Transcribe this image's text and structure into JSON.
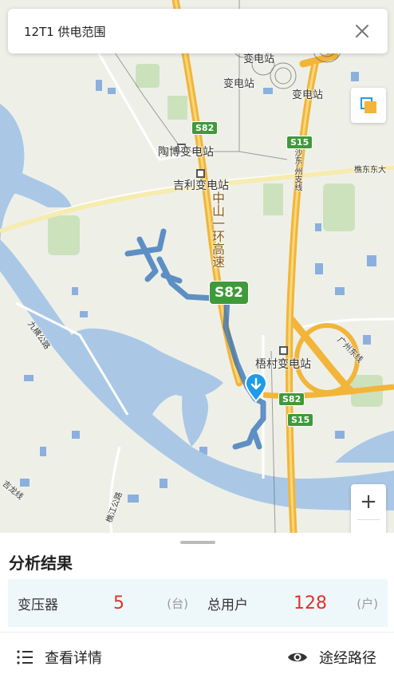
{
  "header": {
    "title": "12T1 供电范围",
    "close_icon": "close-icon"
  },
  "map": {
    "labels": {
      "substation_top1": "变电站",
      "substation_top2": "变电站",
      "substation_top3": "变电站",
      "taobo": "陶博变电站",
      "jili": "吉利变电站",
      "wucun": "梧村变电站",
      "ring_expressway": "中山一环高速",
      "shadong_road": "沙东-州支线",
      "sanzhou_road": "三州支线",
      "jiuwan_road": "九横公路",
      "jiangdong_road": "樵东东大",
      "west_road": "吉龙线",
      "south_road": "樵江公路",
      "east_road": "广州东线"
    },
    "badges": {
      "s82_top": "S82",
      "s15_top": "S15",
      "s82_big": "S82",
      "s82_small": "S82",
      "s15_small": "S15"
    },
    "colors": {
      "water": "#aac8e6",
      "land": "#eef0e8",
      "expressway": "#f2b53a",
      "route": "#2f6fb8",
      "marker": "#1e9be9"
    }
  },
  "controls": {
    "layer_icon": "layers-icon",
    "zoom_in_label": "+"
  },
  "panel": {
    "title": "分析结果",
    "stats": {
      "transformer_label": "变压器",
      "transformer_value": "5",
      "transformer_unit": "(台)",
      "users_label": "总用户",
      "users_value": "128",
      "users_unit": "(户)"
    },
    "actions": {
      "details_label": "查看详情",
      "details_icon": "list-icon",
      "route_label": "途经路径",
      "route_icon": "eye-icon"
    }
  }
}
